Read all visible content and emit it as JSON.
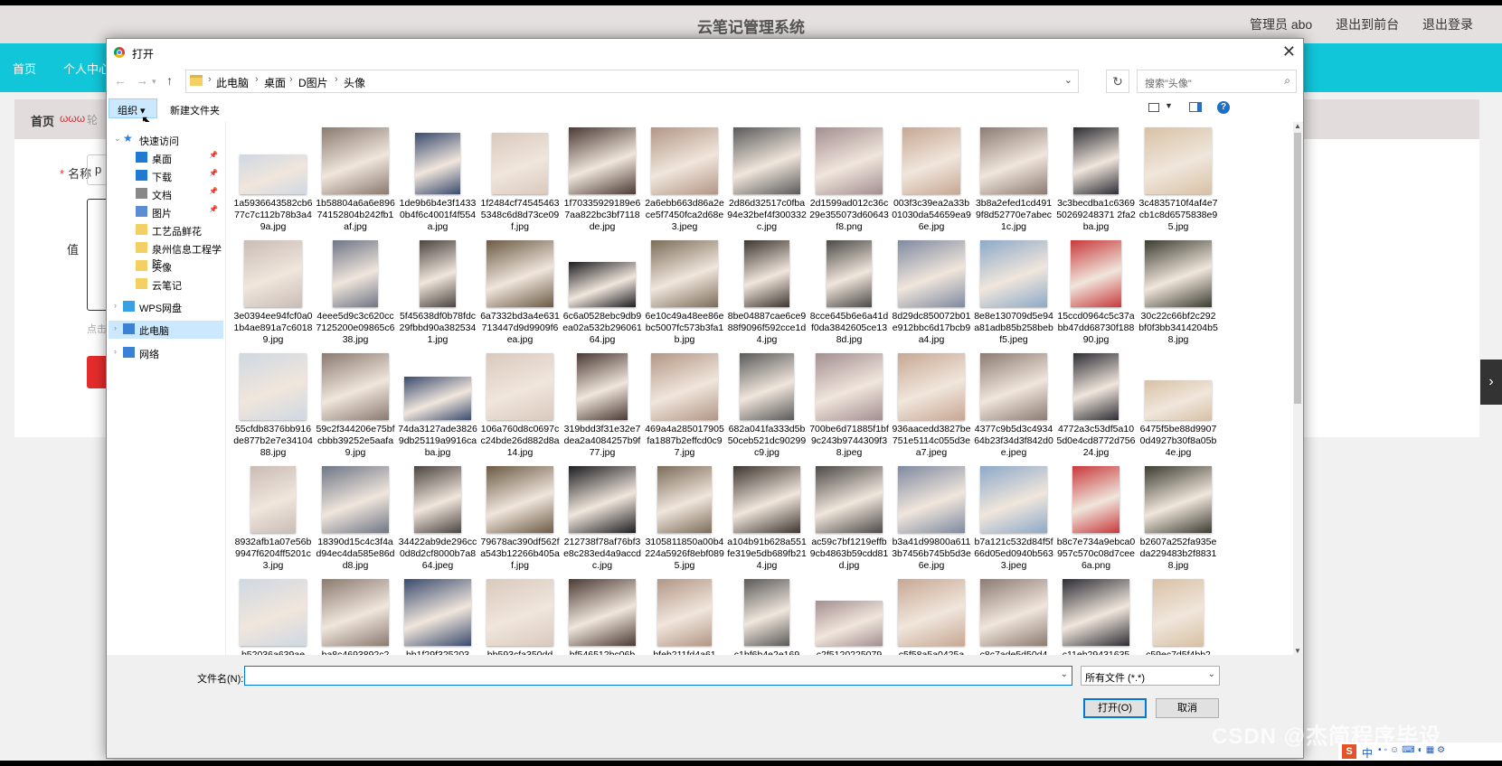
{
  "app": {
    "title": "云笔记管理系统",
    "top_links": [
      "管理员 abo",
      "退出到前台",
      "退出登录"
    ],
    "nav": [
      "首页",
      "个人中心"
    ],
    "breadcrumb": {
      "home": "首页",
      "item": "ωωω",
      "sub": "轮"
    },
    "form": {
      "name_label": "名称",
      "required_mark": "*",
      "name_value": "p",
      "value_label": "值",
      "hint": "点击"
    },
    "side_arrow": "›"
  },
  "dialog": {
    "title": "打开",
    "close": "✕",
    "path": [
      "此电脑",
      "桌面",
      "D图片",
      "头像"
    ],
    "search_placeholder": "搜索\"头像\"",
    "organize": "组织 ▾",
    "new_folder": "新建文件夹",
    "nav_tree": [
      {
        "label": "快速访问",
        "pinned": false
      },
      {
        "label": "桌面",
        "pinned": true
      },
      {
        "label": "下载",
        "pinned": true
      },
      {
        "label": "文档",
        "pinned": true
      },
      {
        "label": "图片",
        "pinned": true
      },
      {
        "label": "工艺品鲜花",
        "pinned": false
      },
      {
        "label": "泉州信息工程学院",
        "pinned": false
      },
      {
        "label": "头像",
        "pinned": false
      },
      {
        "label": "云笔记",
        "pinned": false
      },
      {
        "label": "WPS网盘",
        "pinned": false
      },
      {
        "label": "此电脑",
        "pinned": false
      },
      {
        "label": "网络",
        "pinned": false
      }
    ],
    "files": [
      "1a5936643582cb677c7c112b78b3a49a.jpg",
      "1b58804a6a6e89674152804b242fb1af.jpg",
      "1de9b6b4e3f14330b4f6c4001f4f554a.jpg",
      "1f2484cf745454635348c6d8d73ce09f.jpg",
      "1f70335929189e67aa822bc3bf7118de.jpg",
      "2a6ebb663d86a2ece5f7450fca2d68e3.jpeg",
      "2d86d32517c0fba94e32bef4f300332c.jpg",
      "2d1599ad012c36c29e355073d60643f8.png",
      "003f3c39ea2a33b01030da54659ea96e.jpg",
      "3b8a2efed1cd4919f8d52770e7abec1c.jpg",
      "3c3becdba1c636950269248371 2fa2ba.jpg",
      "3c4835710f4af4e7cb1c8d6575838e95.jpg",
      "3e0394ee94fcf0a01b4ae891a7c60189.jpg",
      "4eee5d9c3c620cc7125200e09865c638.jpg",
      "5f45638df0b78fdc29fbbd90a3825341.jpg",
      "6a7332bd3a4e631713447d9d9909f6ea.jpg",
      "6c6a0528ebc9db9ea02a532b29606164.jpg",
      "6e10c49a48ee86ebc5007fc573b3fa1b.jpg",
      "8be04887cae6ce988f9096f592cce1d4.jpg",
      "8cce645b6e6a41df0da3842605ce138d.jpg",
      "8d29dc850072b01e912bbc6d17bcb9a4.jpg",
      "8e8e130709d5e94a81adb85b258bebf5.jpeg",
      "15ccd0964c5c37abb47dd68730f18890.jpg",
      "30c22c66bf2c292bf0f3bb3414204b58.jpg",
      "55cfdb8376bb916de877b2e7e3410488.jpg",
      "59c2f344206e75bfcbbb39252e5aafa9.jpg",
      "74da3127ade38269db25119a9916caba.jpg",
      "106a760d8c0697cc24bde26d882d8a14.jpg",
      "319bdd3f31e32e7dea2a4084257b9f77.jpg",
      "469a4a285017905fa1887b2effcd0c97.jpg",
      "682a041fa333d5b50ceb521dc90299c9.jpg",
      "700be6d71885f1bf9c243b9744309f38.jpeg",
      "936aacedd3827be751e5114c055d3ea7.jpeg",
      "4377c9b5d3c493464b23f34d3f842d0e.jpeg",
      "4772a3c53df5a105d0e4cd8772d75624.jpg",
      "6475f5be88d99070d4927b30f8a05b4e.jpg",
      "8932afb1a07e56b9947f6204ff5201c3.jpg",
      "18390d15c4c3f4ad94ec4da585e86dd8.jpg",
      "34422ab9de296cc0d8d2cf8000b7a864.jpeg",
      "79678ac390df562fa543b12266b405af.jpg",
      "212738f78af76bf3e8c283ed4a9accdc.jpg",
      "3105811850a00b4224a5926f8ebf0895.jpg",
      "a104b91b628a551fe319e5db689fb214.jpg",
      "ac59c7bf1219effb9cb4863b59cdd81d.jpg",
      "b3a41d99800a6113b7456b745b5d3e6e.jpg",
      "b7a121c532d84f5f66d05ed0940b5633.jpeg",
      "b8c7e734a9ebca0957c570c08d7cee6a.png",
      "b2607a252fa935eda229483b2f88318.jpg",
      "b52036a639ae",
      "ba8c4693892c2",
      "bb1f29f325203",
      "bb593cfa350dd",
      "bf546512bc06b",
      "bfeb211fd4a61",
      "c1bf6b4e2e169",
      "c2f5120225079",
      "c5f58a5a0425a",
      "c8c7ade5d50d4",
      "c11eb29431635",
      "c59ec7d5f4bb2"
    ],
    "filename_label": "文件名(N):",
    "filename_value": "",
    "filetype": "所有文件 (*.*)",
    "open": "打开(O)",
    "cancel": "取消"
  },
  "watermark": "CSDN @杰简程序毕设",
  "tray": {
    "ime_badge": "S",
    "ime_lang": "中"
  }
}
